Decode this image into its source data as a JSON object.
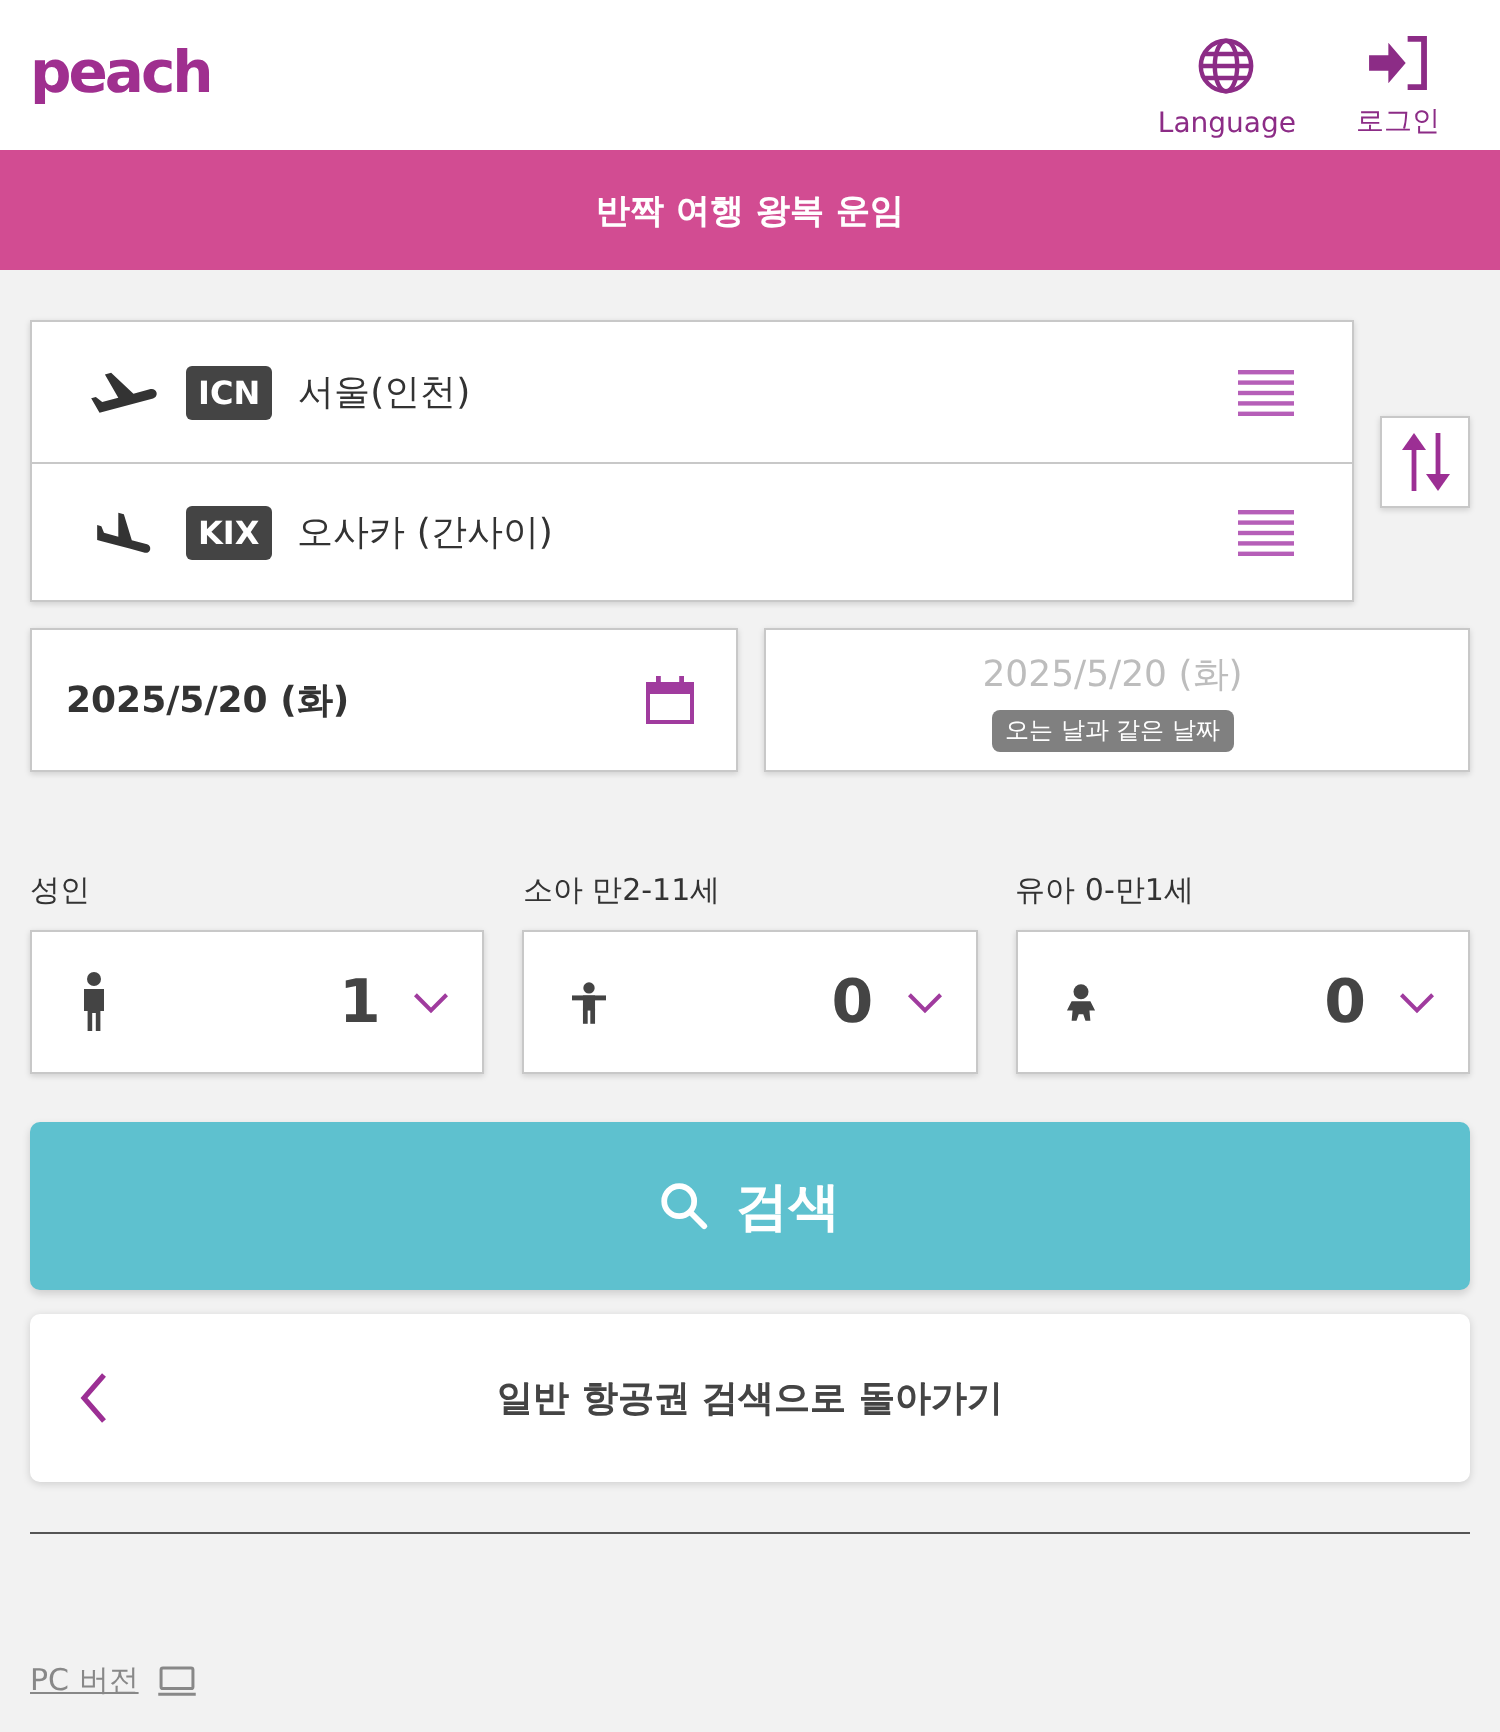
{
  "header": {
    "logo": "peach",
    "language": {
      "label": "Language"
    },
    "login": {
      "label": "로그인"
    }
  },
  "banner": {
    "title": "반짝 여행 왕복 운임"
  },
  "route": {
    "legs": [
      {
        "kind": "departure",
        "code": "ICN",
        "city": "서울(인천)"
      },
      {
        "kind": "arrival",
        "code": "KIX",
        "city": "오사카 (간사이)"
      }
    ]
  },
  "dates": [
    {
      "value": "2025/5/20 (화)",
      "disabled": false
    },
    {
      "value": "2025/5/20 (화)",
      "note": "오는 날과 같은 날짜",
      "disabled": true
    }
  ],
  "passengers": [
    {
      "kind": "adult",
      "label": "성인",
      "count": "1"
    },
    {
      "kind": "child",
      "label": "소아 만2-11세",
      "count": "0"
    },
    {
      "kind": "infant",
      "label": "유아 0-만1세",
      "count": "0"
    }
  ],
  "search_button": {
    "label": "검색"
  },
  "back_button": {
    "label": "일반 항공권 검색으로 돌아가기"
  },
  "footer": {
    "pc_link": "PC 버전"
  }
}
